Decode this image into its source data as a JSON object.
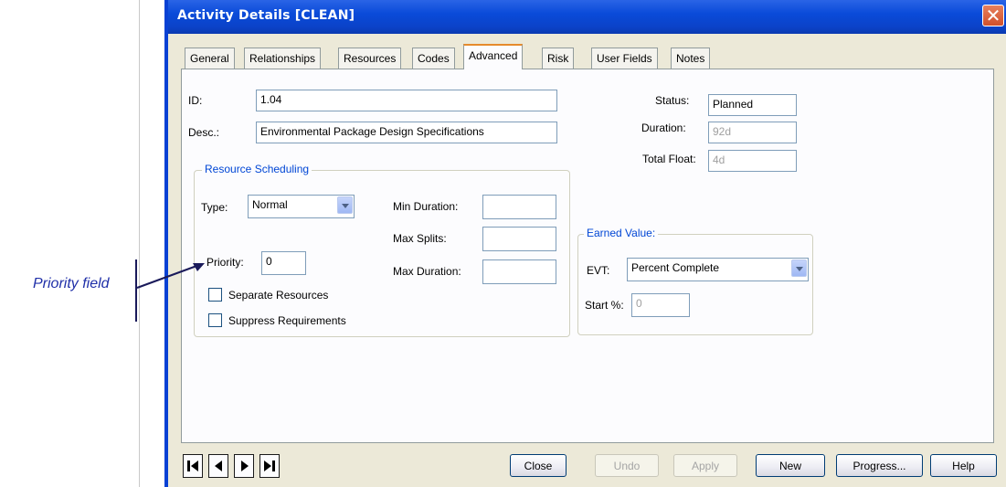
{
  "annotation": {
    "label": "Priority field"
  },
  "window": {
    "title": "Activity Details [CLEAN]",
    "close_glyph": "✕"
  },
  "tabs": [
    {
      "label": "General"
    },
    {
      "label": "Relationships"
    },
    {
      "label": "Resources"
    },
    {
      "label": "Codes"
    },
    {
      "label": "Advanced",
      "active": true
    },
    {
      "label": "Risk"
    },
    {
      "label": "User Fields"
    },
    {
      "label": "Notes"
    }
  ],
  "general": {
    "id_label": "ID:",
    "id_value": "1.04",
    "desc_label": "Desc.:",
    "desc_value": "Environmental Package Design Specifications"
  },
  "status": {
    "status_label": "Status:",
    "status_value": "Planned",
    "duration_label": "Duration:",
    "duration_value": "92d",
    "total_float_label": "Total Float:",
    "total_float_value": "4d"
  },
  "resource_scheduling": {
    "title": "Resource Scheduling",
    "type_label": "Type:",
    "type_value": "Normal",
    "priority_label": "Priority:",
    "priority_value": "0",
    "min_duration_label": "Min Duration:",
    "min_duration_value": "",
    "max_splits_label": "Max Splits:",
    "max_splits_value": "",
    "max_duration_label": "Max Duration:",
    "max_duration_value": "",
    "separate_resources_label": "Separate Resources",
    "separate_resources_checked": false,
    "suppress_requirements_label": "Suppress Requirements",
    "suppress_requirements_checked": false
  },
  "earned_value": {
    "title": "Earned Value:",
    "evt_label": "EVT:",
    "evt_value": "Percent Complete",
    "start_label": "Start %:",
    "start_value": "0"
  },
  "buttons": {
    "close": "Close",
    "undo": "Undo",
    "apply": "Apply",
    "new": "New",
    "progress": "Progress...",
    "help": "Help"
  },
  "navigation": [
    "first-record-icon",
    "previous-record-icon",
    "next-record-icon",
    "last-record-icon"
  ],
  "colors": {
    "title_bar": "#0a4bd9",
    "group_title": "#0046d5",
    "callout": "#1f2fa8",
    "active_tab_accent": "#e68b2c"
  }
}
